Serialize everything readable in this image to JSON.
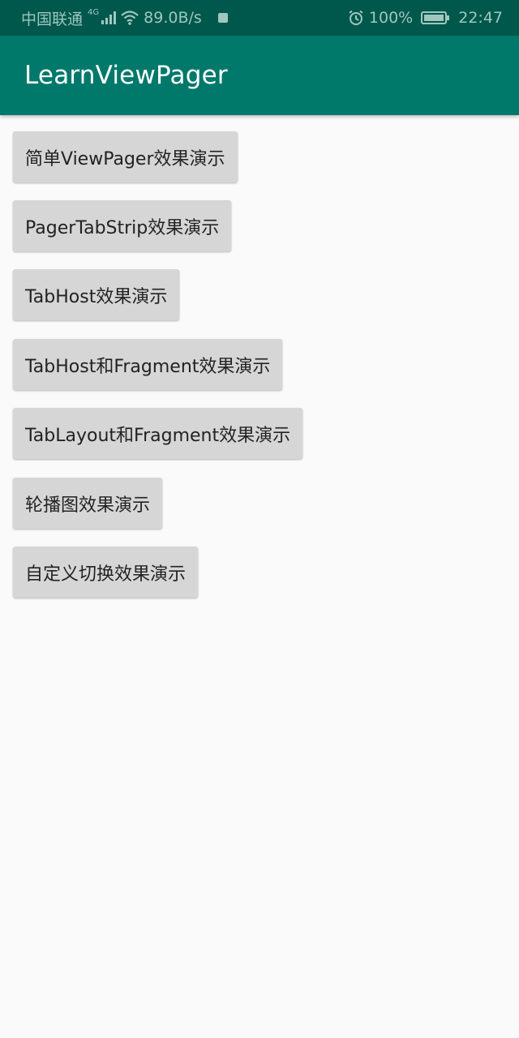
{
  "status_bar": {
    "carrier": "中国联通",
    "network_tag": "4G",
    "speed": "89.0B/s",
    "battery_percent": "100%",
    "time": "22:47",
    "icons": [
      "signal-icon",
      "wifi-icon",
      "notification-icon",
      "alarm-icon",
      "battery-icon"
    ]
  },
  "app_bar": {
    "title": "LearnViewPager",
    "color": "#00796b"
  },
  "buttons": [
    {
      "label": "简单ViewPager效果演示"
    },
    {
      "label": "PagerTabStrip效果演示"
    },
    {
      "label": "TabHost效果演示"
    },
    {
      "label": "TabHost和Fragment效果演示"
    },
    {
      "label": "TabLayout和Fragment效果演示"
    },
    {
      "label": "轮播图效果演示"
    },
    {
      "label": "自定义切换效果演示"
    }
  ]
}
